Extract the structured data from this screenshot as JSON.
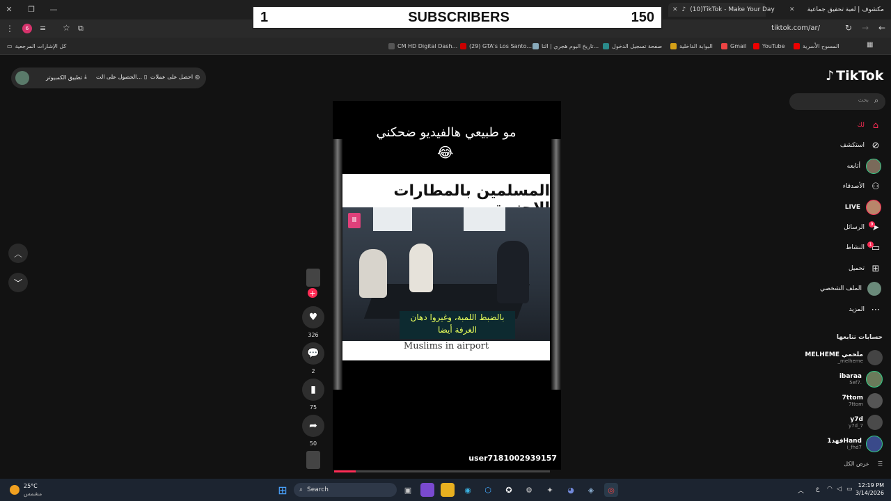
{
  "overlay": {
    "left_number": "1",
    "label": "SUBSCRIBERS",
    "right_number": "150"
  },
  "tabs": [
    {
      "label": "مكشوف | لعبة تحقيق جماعية"
    },
    {
      "label": "(10)TikTok - Make Your Day"
    }
  ],
  "address": {
    "url": "tiktok.com/ar/"
  },
  "bookmarks": {
    "all_label": "كل الإشارات المرجعية",
    "items": [
      "المسوح الأسرية",
      "YouTube",
      "Gmail",
      "البوابة الداخلية",
      "صفحة تسجيل الدخول",
      "تاريخ اليوم هجري | التا...",
      "(29) GTA's Los Santo...",
      "CM HD Digital Dash..."
    ]
  },
  "topbar": {
    "coins": "احصل على عملات",
    "get_app": "الحصول على الت...",
    "pc_app": "تطبيق الكمبيوتر"
  },
  "video": {
    "caption": "مو طبيعي هالفيديو ضحكني",
    "emoji": "😂",
    "headline": "المسلمين بالمطارات الاجنبية",
    "subtitle_line1": "بالضبط اللمبة، وغيروا دهان",
    "subtitle_line2": "الغرفة أيضا",
    "english_caption": "Muslims in airport",
    "username": "user7181002939157",
    "progress": 0.1
  },
  "actions": {
    "likes": "326",
    "comments": "2",
    "saves": "75",
    "shares": "50"
  },
  "sidebar": {
    "logo": "TikTok",
    "search_placeholder": "بحث",
    "nav": [
      {
        "label": "لك",
        "icon": "home-icon"
      },
      {
        "label": "استكشف",
        "icon": "compass-icon"
      },
      {
        "label": "أتابعه",
        "icon": "following-avatar"
      },
      {
        "label": "الأصدقاء",
        "icon": "friends-icon"
      },
      {
        "label": "LIVE",
        "icon": "live-avatar"
      },
      {
        "label": "الرسائل",
        "icon": "send-icon",
        "badge": "9"
      },
      {
        "label": "النشاط",
        "icon": "activity-icon",
        "badge": "1"
      },
      {
        "label": "تحميل",
        "icon": "upload-icon"
      },
      {
        "label": "الملف الشخصي",
        "icon": "profile-avatar"
      },
      {
        "label": "المزيد",
        "icon": "more-icon"
      }
    ],
    "following_title": "حسابات تتابعها",
    "accounts": [
      {
        "name": "MELHEME ملحمي",
        "handle": "_melheme"
      },
      {
        "name": "ibaraa",
        "handle": "5ef7."
      },
      {
        "name": "7ttom",
        "handle": "7ttom"
      },
      {
        "name": "y7d",
        "handle": "y7d_7"
      },
      {
        "name": "فهد1Hand",
        "handle": "i_fhd7"
      }
    ],
    "see_all": "عرض الكل"
  },
  "taskbar": {
    "weather_temp": "25°C",
    "weather_desc": "مشمس",
    "search_label": "Search",
    "time": "12:19 PM",
    "date": "3/14/2026",
    "lang": "ع"
  },
  "colors": {
    "accent": "#fe2c55",
    "bg": "#121212",
    "panel": "#2a2a2a"
  }
}
